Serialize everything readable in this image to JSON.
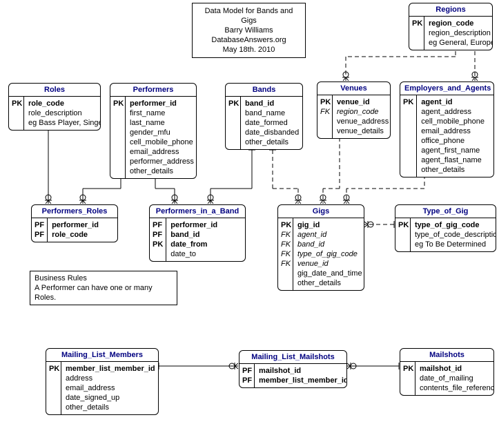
{
  "header": {
    "line1": "Data Model for Bands and Gigs",
    "line2": "Barry Williams",
    "line3": "DatabaseAnswers.org",
    "line4": "May 18th. 2010"
  },
  "rules": {
    "title": "Business Rules",
    "rule1": "A Performer can have one or many Roles."
  },
  "entities": {
    "regions": {
      "title": "Regions",
      "pk": [
        "region_code"
      ],
      "attrs": [
        "region_description",
        "eg General, Europe"
      ]
    },
    "roles": {
      "title": "Roles",
      "pk": [
        "role_code"
      ],
      "attrs": [
        "role_description",
        "eg Bass Player, Singer"
      ]
    },
    "performers": {
      "title": "Performers",
      "pk": [
        "performer_id"
      ],
      "attrs": [
        "first_name",
        "last_name",
        "gender_mfu",
        "cell_mobile_phone",
        "email_address",
        "performer_address",
        "other_details"
      ]
    },
    "bands": {
      "title": "Bands",
      "pk": [
        "band_id"
      ],
      "attrs": [
        "band_name",
        "date_formed",
        "date_disbanded",
        "other_details"
      ]
    },
    "venues": {
      "title": "Venues",
      "pk": [
        "venue_id"
      ],
      "fk": [
        "region_code"
      ],
      "attrs": [
        "venue_address",
        "venue_details"
      ]
    },
    "employers": {
      "title": "Employers_and_Agents",
      "pk": [
        "agent_id"
      ],
      "attrs": [
        "agent_address",
        "cell_mobile_phone",
        "email_address",
        "office_phone",
        "agent_first_name",
        "agent_flast_name",
        "other_details"
      ]
    },
    "performers_roles": {
      "title": "Performers_Roles",
      "pf": [
        "performer_id",
        "role_code"
      ]
    },
    "performers_band": {
      "title": "Performers_in_a_Band",
      "pf": [
        "performer_id",
        "band_id"
      ],
      "pk2": [
        "date_from"
      ],
      "attrs": [
        "date_to"
      ]
    },
    "gigs": {
      "title": "Gigs",
      "pk": [
        "gig_id"
      ],
      "fk": [
        "agent_id",
        "band_id",
        "type_of_gig_code",
        "venue_id"
      ],
      "attrs": [
        "gig_date_and_time",
        "other_details"
      ]
    },
    "type_of_gig": {
      "title": "Type_of_Gig",
      "pk": [
        "type_of_gig_code"
      ],
      "attrs": [
        "type_of_code_description",
        "eg To Be Determined"
      ]
    },
    "mailing_members": {
      "title": "Mailing_List_Members",
      "pk": [
        "member_list_member_id"
      ],
      "attrs": [
        "address",
        "email_address",
        "date_signed_up",
        "other_details"
      ]
    },
    "mailing_mailshots": {
      "title": "Mailing_List_Mailshots",
      "pf": [
        "mailshot_id",
        "member_list_member_id"
      ]
    },
    "mailshots": {
      "title": "Mailshots",
      "pk": [
        "mailshot_id"
      ],
      "attrs": [
        "date_of_mailing",
        "contents_file_reference"
      ]
    }
  }
}
